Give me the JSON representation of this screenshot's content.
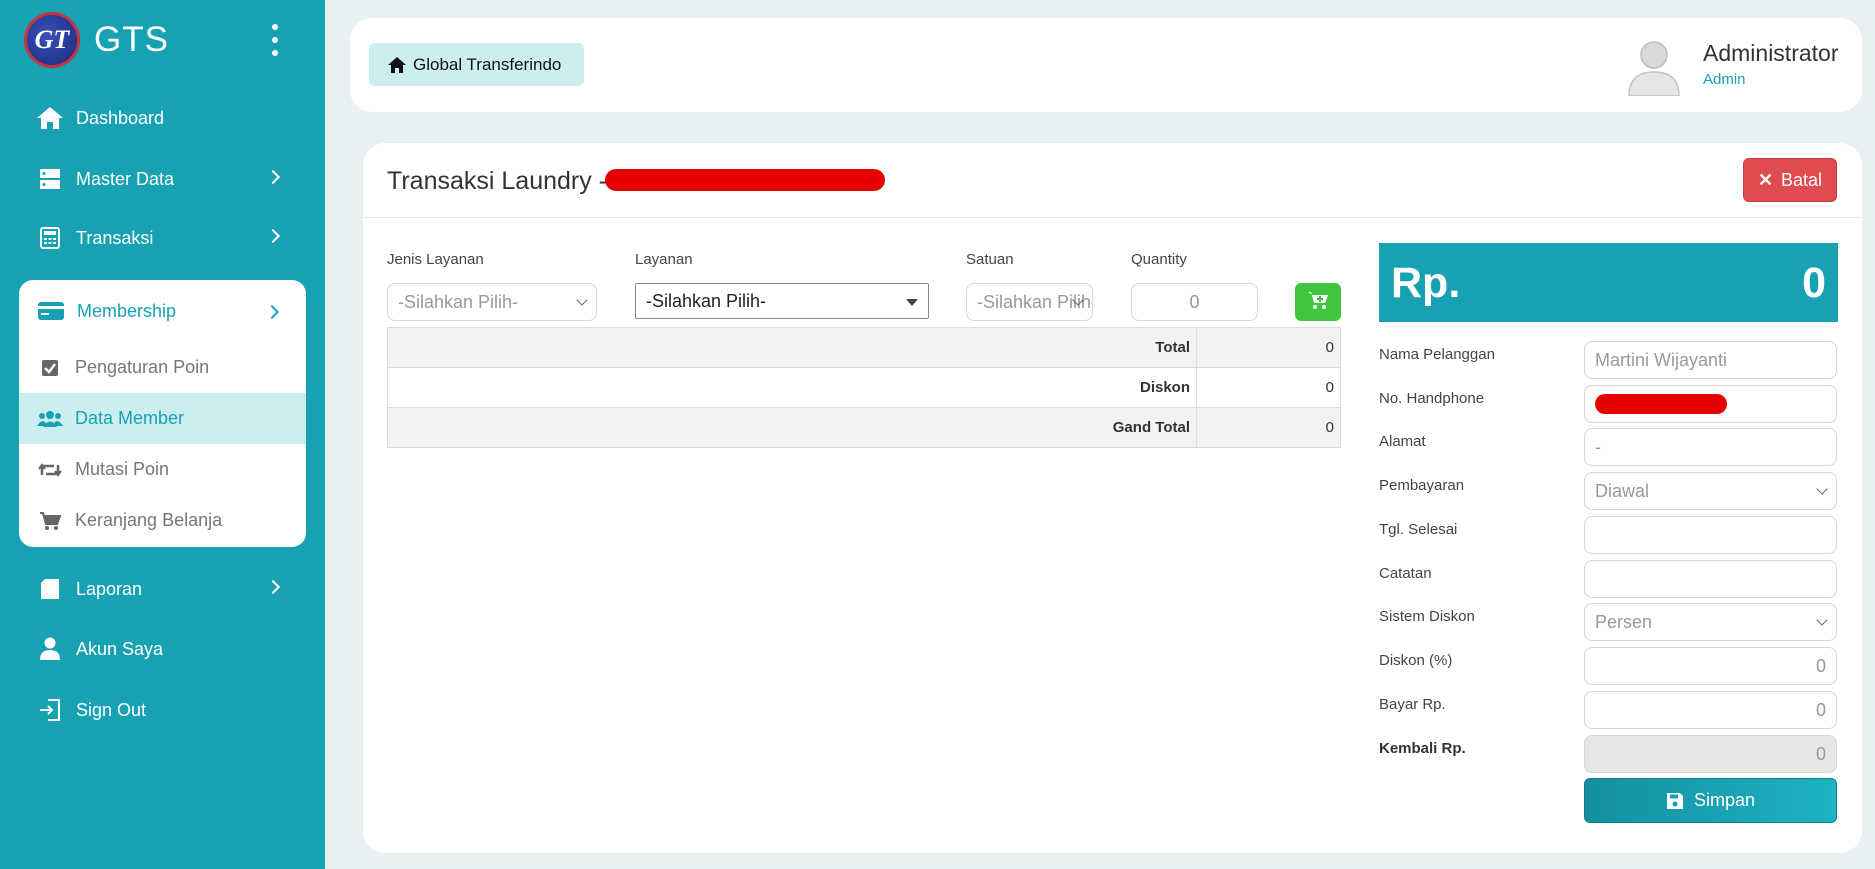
{
  "brand": {
    "logo_text": "GT",
    "name": "GTS"
  },
  "sidebar": {
    "items": [
      {
        "label": "Dashboard",
        "icon": "home-icon"
      },
      {
        "label": "Master Data",
        "icon": "server-icon"
      },
      {
        "label": "Transaksi",
        "icon": "calculator-icon"
      },
      {
        "label": "Membership",
        "icon": "credit-card-icon"
      },
      {
        "label": "Laporan",
        "icon": "book-icon"
      },
      {
        "label": "Akun Saya",
        "icon": "user-icon"
      },
      {
        "label": "Sign Out",
        "icon": "sign-out-icon"
      }
    ],
    "membership_sub": [
      {
        "label": "Pengaturan Poin",
        "icon": "check-square-icon"
      },
      {
        "label": "Data Member",
        "icon": "users-icon",
        "active": true
      },
      {
        "label": "Mutasi Poin",
        "icon": "retweet-icon"
      },
      {
        "label": "Keranjang Belanja",
        "icon": "cart-icon"
      }
    ]
  },
  "header": {
    "home_label": "Global Transferindo",
    "user_name": "Administrator",
    "user_role": "Admin"
  },
  "main": {
    "title": "Transaksi Laundry -",
    "cancel_label": "Batal",
    "fields": {
      "jenis_layanan": {
        "label": "Jenis Layanan",
        "value": "-Silahkan Pilih-"
      },
      "layanan": {
        "label": "Layanan",
        "value": "-Silahkan Pilih-"
      },
      "satuan": {
        "label": "Satuan",
        "value": "-Silahkan Pilih-"
      },
      "quantity": {
        "label": "Quantity",
        "placeholder": "0"
      }
    },
    "totals": [
      {
        "label": "Total",
        "value": "0"
      },
      {
        "label": "Diskon",
        "value": "0"
      },
      {
        "label": "Gand Total",
        "value": "0"
      }
    ]
  },
  "summary": {
    "currency": "Rp.",
    "amount": "0",
    "nama_pelanggan": {
      "label": "Nama Pelanggan",
      "value": "Martini Wijayanti"
    },
    "no_handphone": {
      "label": "No. Handphone"
    },
    "alamat": {
      "label": "Alamat",
      "value": "-"
    },
    "pembayaran": {
      "label": "Pembayaran",
      "value": "Diawal"
    },
    "tgl_selesai": {
      "label": "Tgl. Selesai",
      "value": ""
    },
    "catatan": {
      "label": "Catatan",
      "value": ""
    },
    "sistem_diskon": {
      "label": "Sistem Diskon",
      "value": "Persen"
    },
    "diskon": {
      "label": "Diskon (%)",
      "value": "0"
    },
    "bayar": {
      "label": "Bayar Rp.",
      "value": "0"
    },
    "kembali": {
      "label": "Kembali Rp.",
      "value": "0"
    },
    "save_label": "Simpan"
  },
  "colors": {
    "accent": "#17a2b3",
    "danger": "#e04b4f",
    "success": "#3fc53f",
    "redaction": "#e60000"
  }
}
